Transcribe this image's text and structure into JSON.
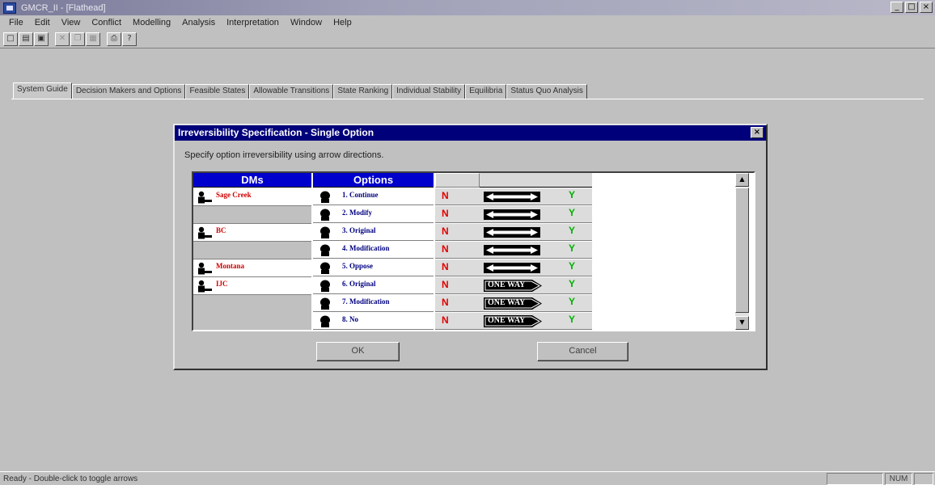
{
  "window": {
    "title": "GMCR_II - [Flathead]"
  },
  "window_buttons": [
    "_",
    "□",
    "×"
  ],
  "menu": [
    "File",
    "Edit",
    "View",
    "Conflict",
    "Modelling",
    "Analysis",
    "Interpretation",
    "Window",
    "Help"
  ],
  "toolbar_icons": [
    "new-file-icon",
    "open-folder-icon",
    "save-icon",
    "cut-icon",
    "copy-icon",
    "paste-icon",
    "print-icon",
    "help-icon"
  ],
  "tabs": [
    {
      "label": "System Guide",
      "active": true
    },
    {
      "label": "Decision Makers and Options",
      "active": false
    },
    {
      "label": "Feasible States",
      "active": false
    },
    {
      "label": "Allowable Transitions",
      "active": false
    },
    {
      "label": "State Ranking",
      "active": false
    },
    {
      "label": "Individual Stability",
      "active": false
    },
    {
      "label": "Equilibria",
      "active": false
    },
    {
      "label": "Status Quo Analysis",
      "active": false
    }
  ],
  "dialog": {
    "title": "Irreversibility Specification - Single Option",
    "close": "×",
    "prompt": "Specify option irreversibility using arrow directions.",
    "col_dms": "DMs",
    "col_options": "Options",
    "dms": [
      {
        "name": "Sage Creek",
        "rows": 2
      },
      {
        "name": "BC",
        "rows": 2
      },
      {
        "name": "Montana",
        "rows": 1
      },
      {
        "name": "IJC",
        "rows": 3
      }
    ],
    "options": [
      {
        "label": "1. Continue",
        "n": "N",
        "y": "Y",
        "arrow": "both"
      },
      {
        "label": "2. Modify",
        "n": "N",
        "y": "Y",
        "arrow": "both"
      },
      {
        "label": "3. Original",
        "n": "N",
        "y": "Y",
        "arrow": "both"
      },
      {
        "label": "4. Modification",
        "n": "N",
        "y": "Y",
        "arrow": "both"
      },
      {
        "label": "5. Oppose",
        "n": "N",
        "y": "Y",
        "arrow": "both"
      },
      {
        "label": "6. Original",
        "n": "N",
        "y": "Y",
        "arrow": "one-way",
        "arrow_text": "ONE WAY"
      },
      {
        "label": "7. Modification",
        "n": "N",
        "y": "Y",
        "arrow": "one-way",
        "arrow_text": "ONE WAY"
      },
      {
        "label": "8. No",
        "n": "N",
        "y": "Y",
        "arrow": "one-way",
        "arrow_text": "ONE WAY"
      }
    ],
    "ok_label": "OK",
    "cancel_label": "Cancel",
    "scroll_up": "▲",
    "scroll_down": "▼"
  },
  "status": {
    "text": "Ready - Double-click to toggle arrows",
    "num": "NUM"
  },
  "colors": {
    "header_blue": "#0000cc",
    "dm_red": "#d00000",
    "option_navy": "#000080",
    "no_red": "#e00000",
    "yes_green": "#00b000",
    "dialog_title": "#00007a"
  }
}
